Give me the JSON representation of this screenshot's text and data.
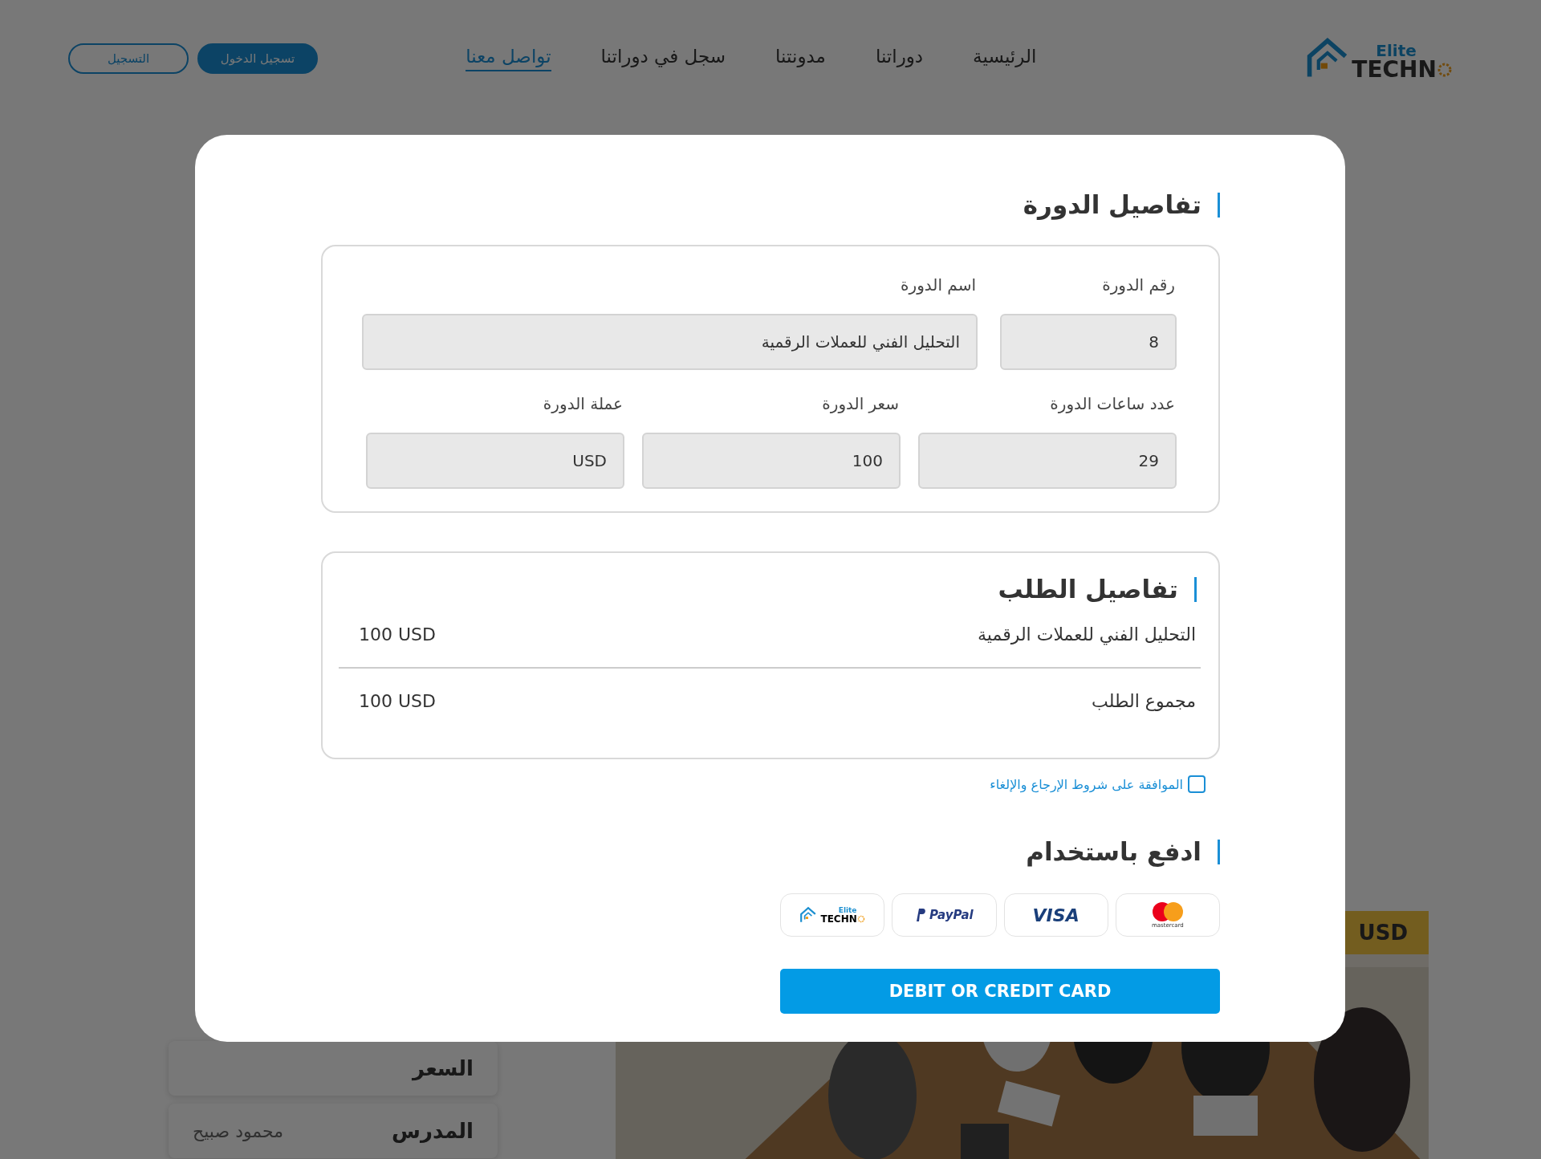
{
  "header": {
    "logo": {
      "small": "Elite",
      "big": "TECHN"
    },
    "nav": [
      {
        "label": "الرئيسية",
        "selected": false
      },
      {
        "label": "دوراتنا",
        "selected": false
      },
      {
        "label": "مدونتنا",
        "selected": false
      },
      {
        "label": "سجل في دوراتنا",
        "selected": false
      },
      {
        "label": "تواصل معنا",
        "selected": true
      }
    ],
    "buttons": [
      {
        "label": "تسجيل الدخول",
        "kind": "filled"
      },
      {
        "label": "التسجيل",
        "kind": "outline"
      }
    ]
  },
  "background": {
    "info_rows": [
      {
        "label": "السعر"
      },
      {
        "label": "المدرس",
        "value": "محمود صبيح"
      }
    ],
    "price_badge": "USD"
  },
  "modal": {
    "course_title": "تفاصيل الدورة",
    "course_fields": [
      {
        "label": "رقم الدورة",
        "value": "8"
      },
      {
        "label": "اسم الدورة",
        "value": "التحليل الفني للعملات الرقمية"
      },
      {
        "label": "عدد ساعات الدورة",
        "value": "29"
      },
      {
        "label": "سعر الدورة",
        "value": "100"
      },
      {
        "label": "عملة الدورة",
        "value": "USD"
      }
    ],
    "order_title": "تفاصيل الطلب",
    "order_rows": [
      {
        "label": "التحليل الفني للعملات الرقمية",
        "amount": "100 USD"
      },
      {
        "label": "مجموع الطلب",
        "amount": "100 USD"
      }
    ],
    "terms": {
      "label": "الموافقة على شروط الإرجاع والإلغاء",
      "checked": false
    },
    "pay_title": "ادفع باستخدام",
    "methods": [
      {
        "kind": "mastercard",
        "label": "mastercard"
      },
      {
        "kind": "visa",
        "label": "VISA"
      },
      {
        "kind": "paypal",
        "label": "PayPal"
      },
      {
        "kind": "elite",
        "small": "Elite",
        "label": "TECHN"
      }
    ],
    "card_button": "DEBIT OR CREDIT CARD"
  }
}
